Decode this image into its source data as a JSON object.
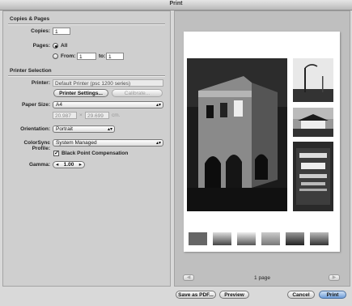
{
  "window": {
    "title": "Print"
  },
  "copies_pages": {
    "section_title": "Copies & Pages",
    "copies_label": "Copies:",
    "copies_value": "1",
    "pages_label": "Pages:",
    "all_label": "All",
    "from_label": "From:",
    "from_value": "1",
    "to_label": "to:",
    "to_value": "1"
  },
  "printer_selection": {
    "section_title": "Printer Selection",
    "printer_label": "Printer:",
    "printer_value": "Default Printer (psc 1200 series)",
    "printer_settings_button": "Printer Settings...",
    "calibrate_button": "Calibrate...",
    "paper_size_label": "Paper Size:",
    "paper_size_value": "A4",
    "paper_width": "20.987",
    "times_symbol": "×",
    "paper_height": "29.699",
    "paper_unit": "cm.",
    "orientation_label": "Orientation:",
    "orientation_value": "Portrait",
    "colorsync_label": "ColorSync Profile:",
    "colorsync_value": "System Managed",
    "black_point_label": "Black Point Compensation",
    "black_point_checked": true,
    "gamma_label": "Gamma:",
    "gamma_value": "1.00"
  },
  "preview": {
    "page_count": "1 page",
    "prev_arrow": "◀",
    "next_arrow": "▶"
  },
  "footer": {
    "save_pdf_button": "Save as PDF...",
    "preview_button": "Preview",
    "cancel_button": "Cancel",
    "print_button": "Print"
  }
}
